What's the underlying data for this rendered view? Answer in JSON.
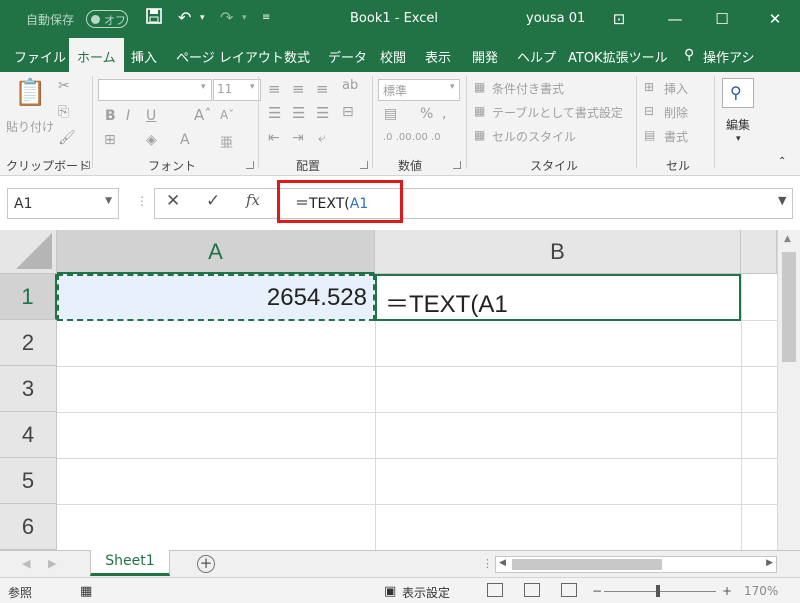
{
  "titlebar": {
    "autosave_label": "自動保存",
    "autosave_state": "オフ",
    "doc_title": "Book1  -  Excel",
    "user": "yousa 01"
  },
  "tabs": [
    "ファイル",
    "ホーム",
    "挿入",
    "ページ レイアウト",
    "数式",
    "データ",
    "校閲",
    "表示",
    "開発",
    "ヘルプ",
    "ATOK拡張ツール",
    "操作アシ"
  ],
  "active_tab": "ホーム",
  "ribbon": {
    "clipboard": {
      "paste": "貼り付け",
      "label": "クリップボード"
    },
    "font": {
      "size": "11",
      "label": "フォント"
    },
    "alignment": {
      "label": "配置"
    },
    "number": {
      "format": "標準",
      "label": "数値"
    },
    "styles": {
      "conditional": "条件付き書式",
      "table": "テーブルとして書式設定",
      "cell": "セルのスタイル",
      "label": "スタイル"
    },
    "cells": {
      "insert": "挿入",
      "delete": "削除",
      "format": "書式",
      "label": "セル"
    },
    "editing": {
      "label": "編集"
    }
  },
  "formula_bar": {
    "name_box": "A1",
    "formula_prefix": "＝TEXT(",
    "formula_ref": "A1"
  },
  "grid": {
    "columns": [
      "A",
      "B"
    ],
    "rows": [
      "1",
      "2",
      "3",
      "4",
      "5",
      "6"
    ],
    "cells": {
      "A1": "2654.528",
      "B1": "＝TEXT(A1"
    }
  },
  "sheet_tabs": [
    "Sheet1"
  ],
  "status_bar": {
    "mode": "参照",
    "display_settings": "表示設定",
    "zoom": "170%"
  },
  "colors": {
    "accent": "#217346",
    "highlight": "#e0191a",
    "reference": "#2f6fc6"
  }
}
